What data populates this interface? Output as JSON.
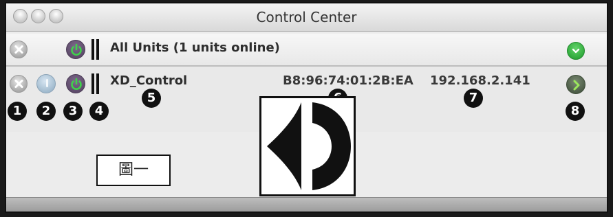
{
  "window": {
    "title": "Control Center"
  },
  "all_units": {
    "label": "All Units (1 units online)"
  },
  "device": {
    "name": "XD_Control",
    "mac": "B8:96:74:01:2B:EA",
    "ip": "192.168.2.141"
  },
  "callouts": [
    "1",
    "2",
    "3",
    "4",
    "5",
    "6",
    "7",
    "8"
  ],
  "figure_label": "圖一",
  "colors": {
    "green_button": "#2ea83a",
    "power_button": "#5d4a6a",
    "arrow_button": "#4a5a45"
  },
  "icons": {
    "close": "close-icon",
    "power": "power-icon",
    "info": "info-icon",
    "level_meter": "level-meter-icon",
    "dropdown": "chevron-down-icon",
    "go": "chevron-right-icon",
    "logo": "speaker-logo-icon"
  }
}
